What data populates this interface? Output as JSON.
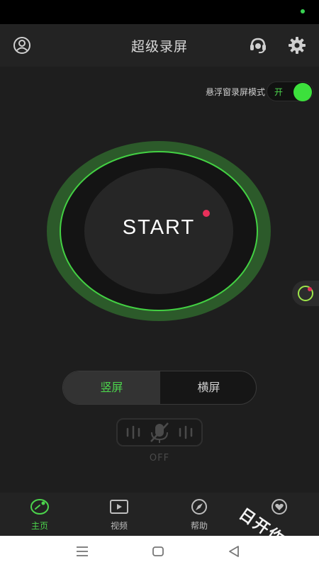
{
  "header": {
    "title": "超级录屏",
    "icons": {
      "profile": "user-circle-icon",
      "support": "headset-icon",
      "settings": "gear-icon"
    }
  },
  "floating_mode": {
    "label": "悬浮窗录屏模式",
    "toggle_text": "开",
    "enabled": true
  },
  "record": {
    "start_label": "START"
  },
  "orientation": {
    "options": [
      "竖屏",
      "横屏"
    ],
    "selected": "竖屏"
  },
  "mic": {
    "status": "OFF",
    "icon": "mic-muted-icon"
  },
  "tabs": [
    {
      "label": "主页",
      "icon": "record-icon",
      "active": true
    },
    {
      "label": "视频",
      "icon": "play-icon",
      "active": false
    },
    {
      "label": "帮助",
      "icon": "compass-icon",
      "active": false
    },
    {
      "label": "",
      "icon": "heart-icon",
      "active": false
    }
  ],
  "watermark": {
    "text": "日开作"
  },
  "colors": {
    "accent": "#3ce03c",
    "alert": "#e8305a",
    "background": "#1e1e1e"
  }
}
